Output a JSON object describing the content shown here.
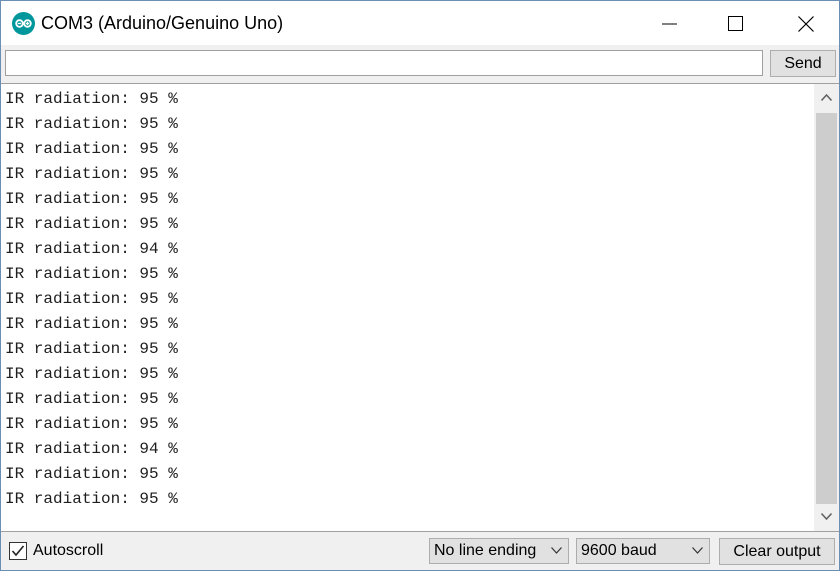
{
  "window": {
    "title": "COM3 (Arduino/Genuino Uno)",
    "app_icon": "arduino-logo-icon",
    "controls": [
      "minimize-icon",
      "maximize-icon",
      "close-icon"
    ],
    "accent_color": "#00979c"
  },
  "send_row": {
    "input_value": "",
    "send_label": "Send"
  },
  "output": {
    "lines": [
      "IR radiation: 95 %",
      "IR radiation: 95 %",
      "IR radiation: 95 %",
      "IR radiation: 95 %",
      "IR radiation: 95 %",
      "IR radiation: 95 %",
      "IR radiation: 94 %",
      "IR radiation: 95 %",
      "IR radiation: 95 %",
      "IR radiation: 95 %",
      "IR radiation: 95 %",
      "IR radiation: 95 %",
      "IR radiation: 95 %",
      "IR radiation: 95 %",
      "IR radiation: 94 %",
      "IR radiation: 95 %",
      "IR radiation: 95 %"
    ]
  },
  "bottom": {
    "autoscroll_label": "Autoscroll",
    "autoscroll_checked": true,
    "line_ending": "No line ending",
    "baud_rate": "9600 baud",
    "clear_label": "Clear output"
  }
}
